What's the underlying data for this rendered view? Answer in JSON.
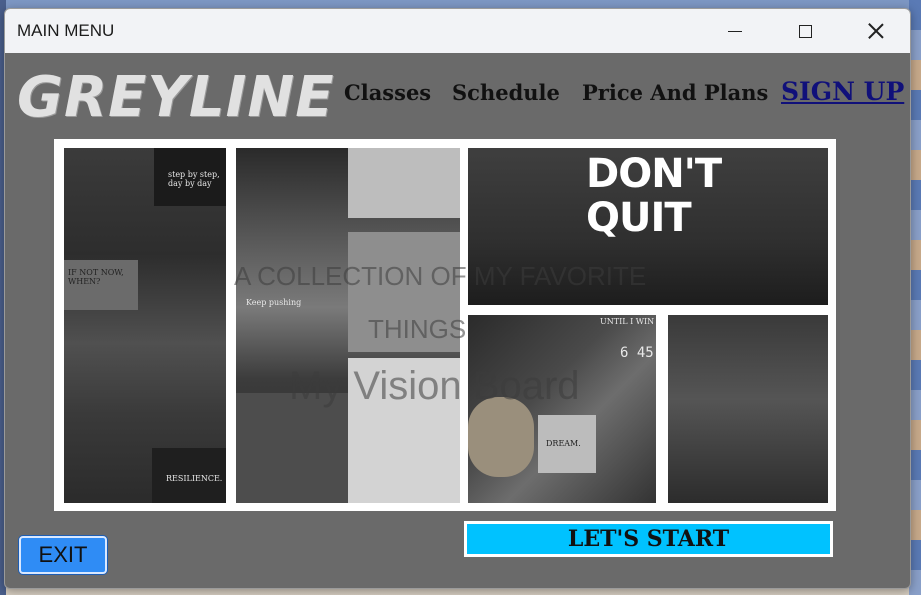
{
  "window": {
    "title": "MAIN MENU"
  },
  "header": {
    "logo": "GREYLINE",
    "nav": {
      "classes": "Classes",
      "schedule": "Schedule",
      "price": "Price And Plans",
      "signup": "SIGN UP"
    }
  },
  "board": {
    "headline": "DON'T\nQUIT",
    "overlay_line1": "A COLLECTION OF MY FAVORITE",
    "overlay_line2": "THINGS",
    "overlay_title": "My Vision Board",
    "tile_labels": {
      "step": "step by step, day by day",
      "ifnot": "IF NOT NOW, WHEN?",
      "keep": "Keep pushing",
      "resilience": "RESILIENCE.",
      "dream": "DREAM.",
      "until": "UNTIL I WIN",
      "clock": "6 45"
    }
  },
  "actions": {
    "exit": "EXIT",
    "start": "LET'S START"
  },
  "colors": {
    "window_bg": "#6a6a6a",
    "exit_bg": "#2f8cf5",
    "start_bg": "#00c2ff",
    "signup": "#10107a"
  }
}
